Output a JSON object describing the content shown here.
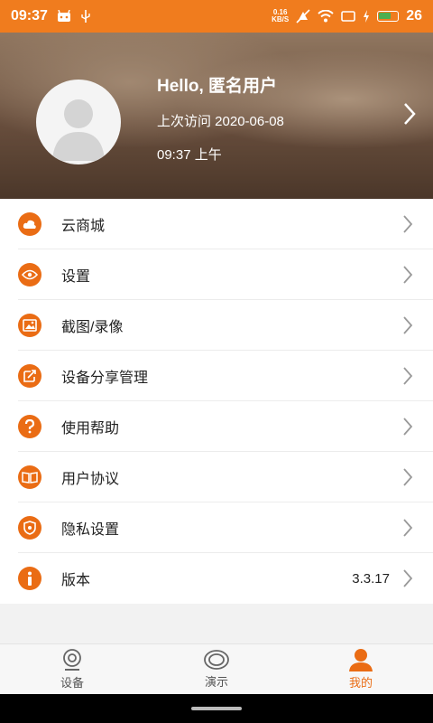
{
  "status_bar": {
    "time": "09:37",
    "net_speed_top": "0.16",
    "net_speed_bottom": "KB/S",
    "battery": "26"
  },
  "profile": {
    "greeting": "Hello, 匿名用户",
    "last_visit": "上次访问 2020-06-08",
    "visit_time": "09:37 上午"
  },
  "menu": [
    {
      "label": "云商城",
      "icon": "cloud-icon",
      "value": ""
    },
    {
      "label": "设置",
      "icon": "eye-icon",
      "value": ""
    },
    {
      "label": "截图/录像",
      "icon": "image-icon",
      "value": ""
    },
    {
      "label": "设备分享管理",
      "icon": "share-icon",
      "value": ""
    },
    {
      "label": "使用帮助",
      "icon": "question-icon",
      "value": ""
    },
    {
      "label": "用户协议",
      "icon": "book-icon",
      "value": ""
    },
    {
      "label": "隐私设置",
      "icon": "shield-icon",
      "value": ""
    },
    {
      "label": "版本",
      "icon": "info-icon",
      "value": "3.3.17"
    }
  ],
  "bottom_nav": [
    {
      "label": "设备",
      "icon": "camera-icon",
      "active": false
    },
    {
      "label": "演示",
      "icon": "demo-icon",
      "active": false
    },
    {
      "label": "我的",
      "icon": "person-icon",
      "active": true
    }
  ],
  "colors": {
    "accent": "#ea6c14",
    "status_bar": "#f07c1e",
    "battery": "#4caf50"
  }
}
